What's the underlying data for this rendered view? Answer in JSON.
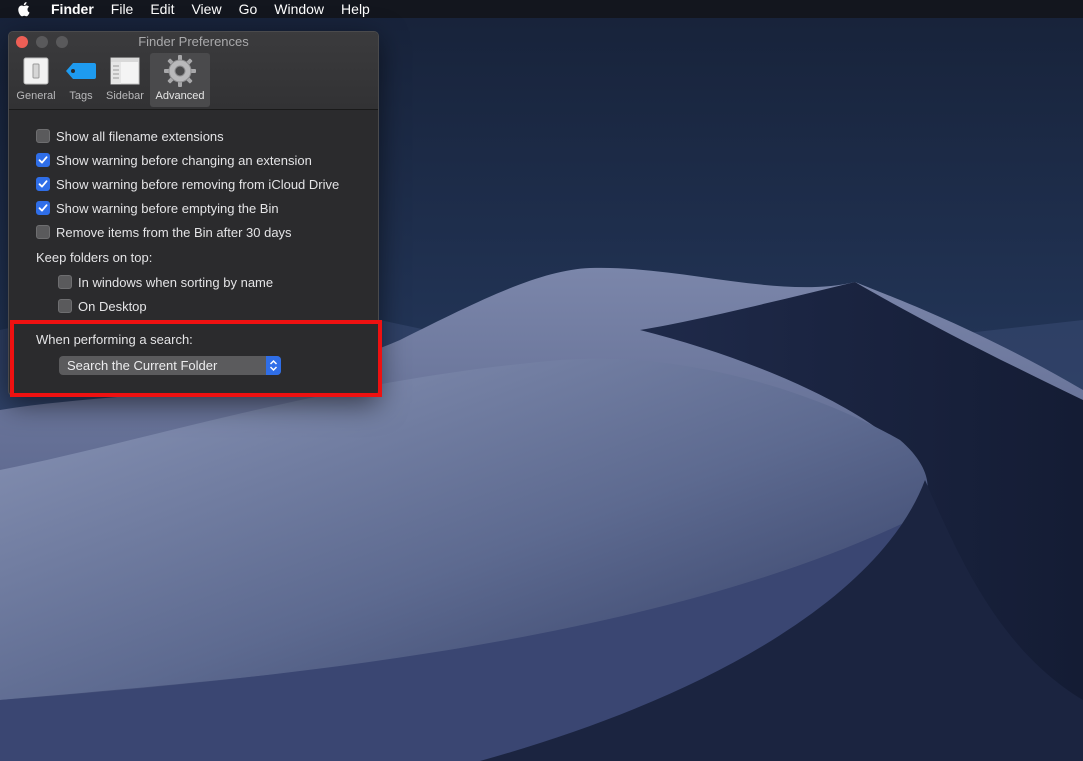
{
  "menubar": {
    "apple_icon": "apple-icon",
    "app_name": "Finder",
    "items": [
      "File",
      "Edit",
      "View",
      "Go",
      "Window",
      "Help"
    ]
  },
  "window": {
    "title": "Finder Preferences",
    "toolbar": {
      "general": "General",
      "tags": "Tags",
      "sidebar": "Sidebar",
      "advanced": "Advanced"
    },
    "options": {
      "show_extensions": "Show all filename extensions",
      "warn_extension": "Show warning before changing an extension",
      "warn_icloud": "Show warning before removing from iCloud Drive",
      "warn_bin": "Show warning before emptying the Bin",
      "remove_bin": "Remove items from the Bin after 30 days"
    },
    "keep_folders": {
      "heading": "Keep folders on top:",
      "windows": "In windows when sorting by name",
      "desktop": "On Desktop"
    },
    "search": {
      "heading": "When performing a search:",
      "selected": "Search the Current Folder"
    },
    "checked": {
      "show_extensions": false,
      "warn_extension": true,
      "warn_icloud": true,
      "warn_bin": true,
      "remove_bin": false,
      "keep_windows": false,
      "keep_desktop": false
    }
  },
  "colors": {
    "accent": "#2f6ee8",
    "highlight_box": "#ee1111",
    "window_bg": "#2b2b2d"
  }
}
